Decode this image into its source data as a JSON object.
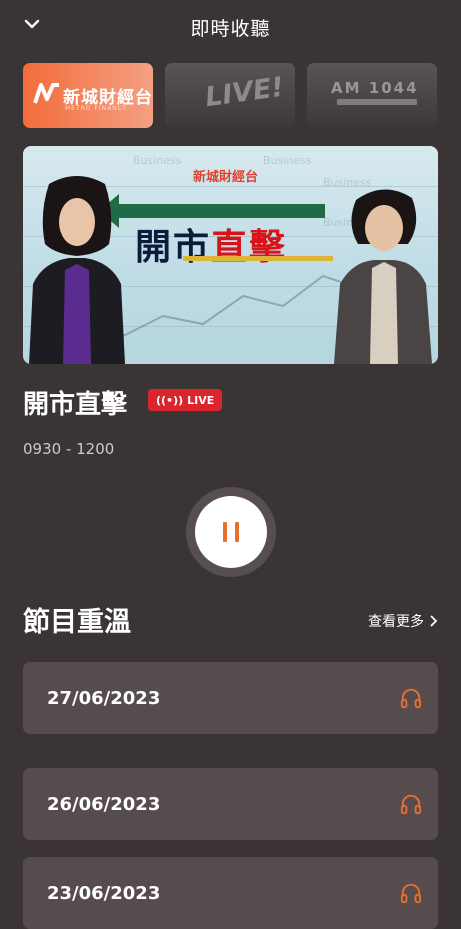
{
  "header": {
    "title": "即時收聽"
  },
  "stations": [
    {
      "label": "新城財經台",
      "sub": "METRO FINANCE"
    },
    {
      "label": "LIVE!"
    },
    {
      "label": "AM 1044"
    }
  ],
  "banner": {
    "logo": "新城財經台",
    "title_a": "開市",
    "title_b": "直擊",
    "ghost_text": "Business"
  },
  "now_playing": {
    "name": "開市直擊",
    "badge": "LIVE",
    "time": "0930 - 1200",
    "state": "playing"
  },
  "replay": {
    "title": "節目重溫",
    "more": "查看更多",
    "items": [
      {
        "date": "27/06/2023"
      },
      {
        "date": "26/06/2023"
      },
      {
        "date": "23/06/2023"
      }
    ]
  },
  "colors": {
    "accent": "#e8702f",
    "live": "#d9252b",
    "bg": "#3a3434",
    "card": "#574c4d"
  },
  "icons": [
    "chevron-down-icon",
    "live-signal-icon",
    "pause-icon",
    "chevron-right-icon",
    "headphones-icon"
  ]
}
